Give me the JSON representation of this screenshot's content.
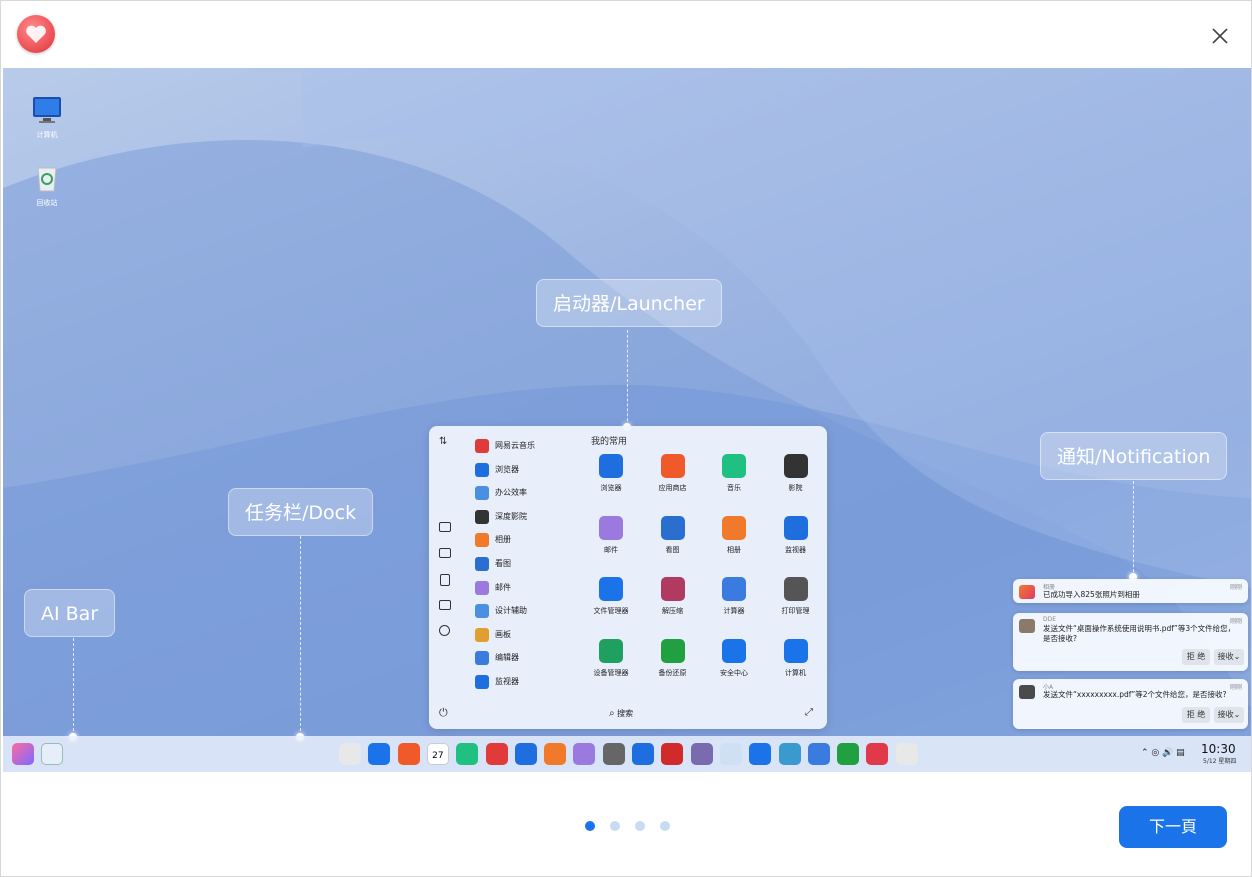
{
  "window": {
    "logo_icon": "deepin-love-logo-icon",
    "close_icon": "close-icon"
  },
  "desktop": {
    "icons": [
      {
        "label": "计算机",
        "icon": "computer-icon"
      },
      {
        "label": "回收站",
        "icon": "trash-icon"
      }
    ]
  },
  "callouts": {
    "launcher": "启动器/Launcher",
    "dock": "任务栏/Dock",
    "aibar": "AI Bar",
    "notification": "通知/Notification"
  },
  "launcher": {
    "sort_icon": "sort-icon",
    "list": [
      {
        "label": "网易云音乐",
        "color": "#e03a3a"
      },
      {
        "label": "浏览器",
        "color": "#1e6ee0"
      },
      {
        "label": "办公效率",
        "color": "#4a90e2"
      },
      {
        "label": "深度影院",
        "color": "#333333"
      },
      {
        "label": "相册",
        "color": "#f07a2a"
      },
      {
        "label": "看图",
        "color": "#2a6fd0"
      },
      {
        "label": "邮件",
        "color": "#9a7adf"
      },
      {
        "label": "设计辅助",
        "color": "#4a90e2"
      },
      {
        "label": "画板",
        "color": "#e0a030"
      },
      {
        "label": "编辑器",
        "color": "#3a7be0"
      },
      {
        "label": "监视器",
        "color": "#1e6ee0"
      }
    ],
    "favorites_title": "我的常用",
    "favorites": [
      {
        "label": "浏览器",
        "color": "#1e6ee0"
      },
      {
        "label": "应用商店",
        "color": "#f05a2a"
      },
      {
        "label": "音乐",
        "color": "#20c080"
      },
      {
        "label": "影院",
        "color": "#333333"
      },
      {
        "label": "邮件",
        "color": "#9a7adf"
      },
      {
        "label": "看图",
        "color": "#2a6fd0"
      },
      {
        "label": "相册",
        "color": "#f07a2a"
      },
      {
        "label": "监视器",
        "color": "#1e6ee0"
      },
      {
        "label": "文件管理器",
        "color": "#1a73e8"
      },
      {
        "label": "解压缩",
        "color": "#b03a60"
      },
      {
        "label": "计算器",
        "color": "#3a7be0"
      },
      {
        "label": "打印管理",
        "color": "#555555"
      },
      {
        "label": "设备管理器",
        "color": "#20a060"
      },
      {
        "label": "备份还原",
        "color": "#20a040"
      },
      {
        "label": "安全中心",
        "color": "#1a73e8"
      },
      {
        "label": "计算机",
        "color": "#1a73e8"
      }
    ],
    "search_label": "搜索",
    "power_icon": "power-icon",
    "expand_icon": "expand-icon"
  },
  "notifications": [
    {
      "app": "相册",
      "action": "刚刚",
      "message": "已成功导入825张照片到相册",
      "buttons": []
    },
    {
      "app": "DDE",
      "action": "刚刚",
      "message": "发送文件“桌面操作系统使用说明书.pdf”等3个文件给您，是否接收?",
      "buttons": [
        "拒 绝",
        "接收"
      ]
    },
    {
      "app": "小A",
      "action": "刚刚",
      "message": "发送文件“xxxxxxxxx.pdf”等2个文件给您，是否接收?",
      "buttons": [
        "拒 绝",
        "接收"
      ]
    }
  ],
  "tray": {
    "time": "10:30",
    "date": "5/12 星期四"
  },
  "dock_calendar_day": "27",
  "pagination": {
    "total": 4,
    "active": 0
  },
  "next_button": "下一頁"
}
